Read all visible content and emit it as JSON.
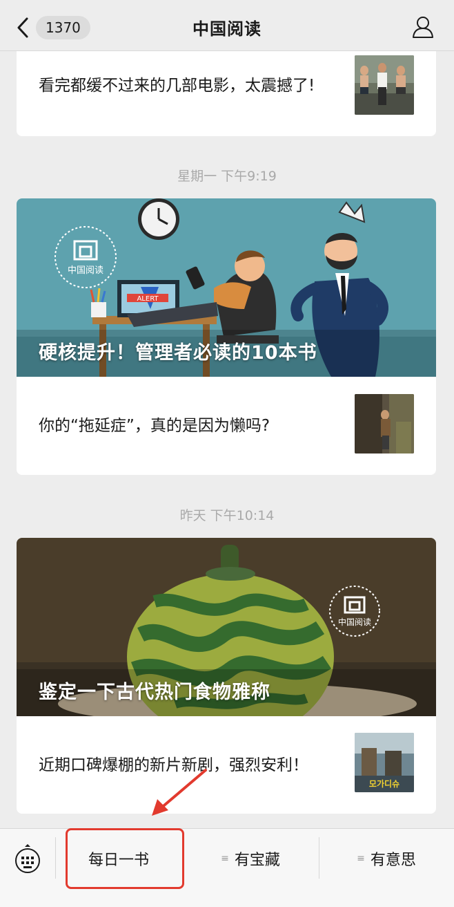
{
  "nav": {
    "back_count": "1370",
    "title": "中国阅读"
  },
  "feed": [
    {
      "article": "看完都缓不过来的几部电影，太震撼了!"
    },
    {
      "time": "星期一 下午9:19",
      "banner_caption": "硬核提升！管理者必读的10本书",
      "banner_logo_text": "中国阅读",
      "alert_text": "ALERT",
      "article": "你的“拖延症”，真的是因为懒吗?"
    },
    {
      "time": "昨天 下午10:14",
      "banner_caption": "鉴定一下古代热门食物雅称",
      "banner_logo_text": "中国阅读",
      "article": "近期口碑爆棚的新片新剧，强烈安利！",
      "poster_text": "모가디슈"
    }
  ],
  "menu": [
    {
      "label": "每日一书"
    },
    {
      "label": "有宝藏"
    },
    {
      "label": "有意思"
    }
  ],
  "colors": {
    "highlight": "#e23a2e",
    "background": "#ededed"
  }
}
